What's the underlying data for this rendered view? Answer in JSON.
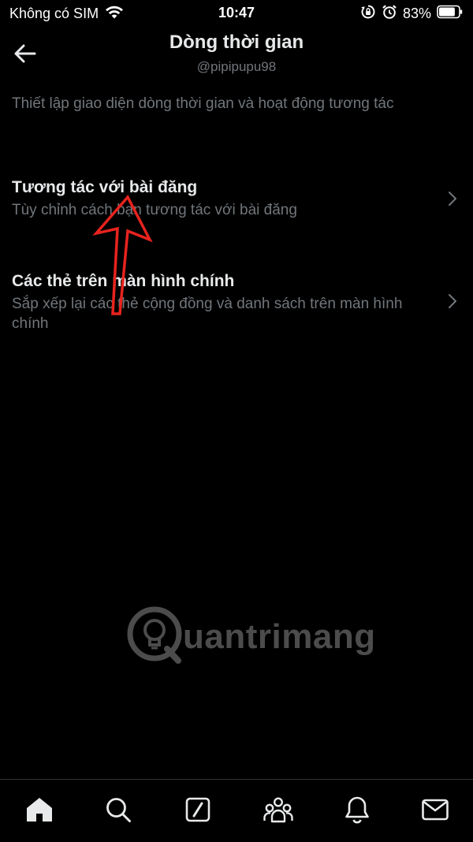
{
  "status_bar": {
    "carrier": "Không có SIM",
    "time": "10:47",
    "battery": "83%",
    "battery_level": 0.83,
    "icons": [
      "wifi-icon",
      "orientation-lock-icon",
      "alarm-icon",
      "battery-icon"
    ]
  },
  "header": {
    "title": "Dòng thời gian",
    "handle": "@pipipupu98"
  },
  "description": "Thiết lập giao diện dòng thời gian và hoạt động tương tác",
  "settings": [
    {
      "title": "Tương tác với bài đăng",
      "subtitle": "Tùy chỉnh cách bạn tương tác với bài đăng"
    },
    {
      "title": "Các thẻ trên màn hình chính",
      "subtitle": "Sắp xếp lại các thẻ cộng đồng và danh sách trên màn hình chính"
    }
  ],
  "watermark": {
    "text": "uantrimang"
  },
  "tabbar": {
    "items": [
      "home-icon",
      "search-icon",
      "grok-icon",
      "communities-icon",
      "notifications-icon",
      "messages-icon"
    ]
  },
  "colors": {
    "background": "#000000",
    "primary_text": "#e7e9ea",
    "secondary_text": "#71767b",
    "annotation": "#e8231e"
  }
}
